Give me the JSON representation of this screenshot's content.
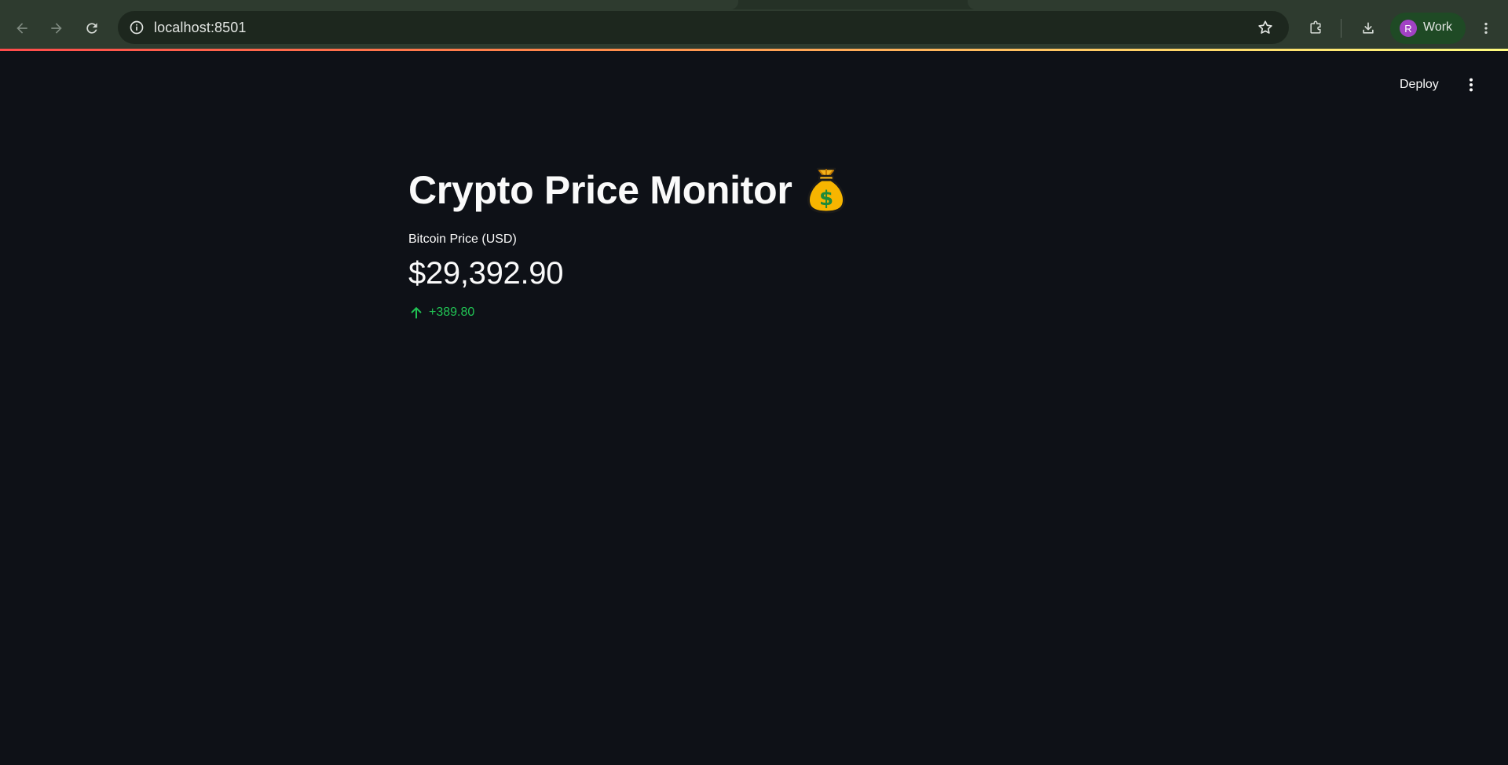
{
  "browser": {
    "url": "localhost:8501",
    "profile_initial": "R",
    "profile_name": "Work",
    "colors": {
      "frame": "#2e3b2f",
      "omnibox": "#1d271e",
      "profile_chip": "#1f4a25",
      "avatar": "#a142c4"
    },
    "icons": [
      "back-arrow-icon",
      "forward-arrow-icon",
      "reload-icon",
      "site-info-icon",
      "bookmark-star-icon",
      "extensions-icon",
      "download-icon",
      "kebab-menu-icon"
    ]
  },
  "app": {
    "header": {
      "deploy_label": "Deploy",
      "menu_icon": "vertical-dots-icon"
    },
    "title": "Crypto Price Monitor",
    "title_icon": "money-bag-icon",
    "metric": {
      "label": "Bitcoin Price (USD)",
      "value": "$29,392.90",
      "delta": "+389.80",
      "delta_direction": "up",
      "delta_color": "#21c354"
    },
    "colors": {
      "background": "#0e1117",
      "text": "#fafafa"
    }
  }
}
